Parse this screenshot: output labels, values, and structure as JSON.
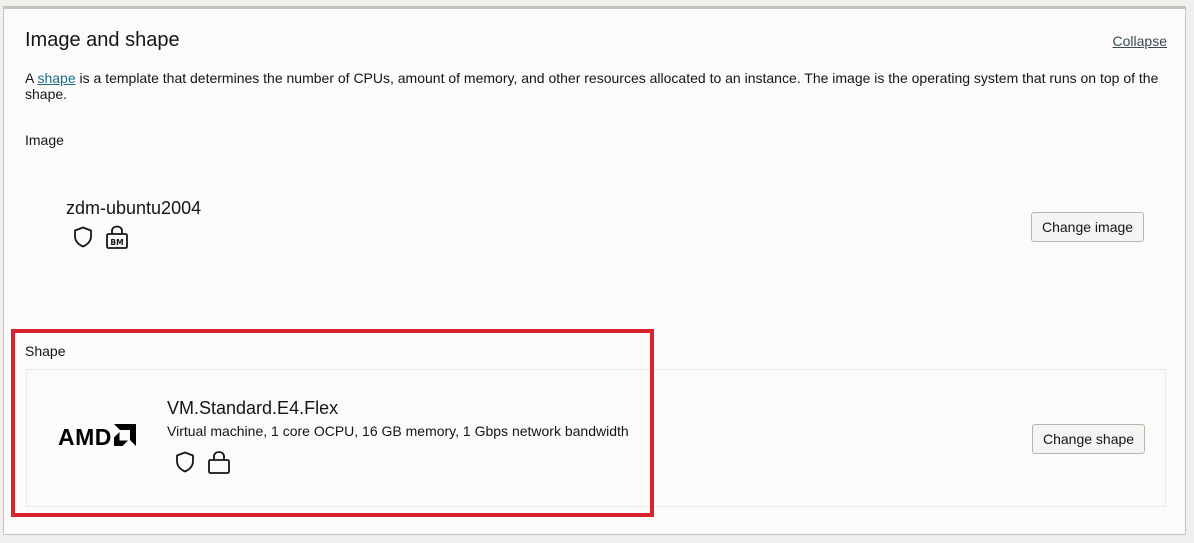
{
  "header": {
    "title": "Image and shape",
    "collapse_label": "Collapse"
  },
  "description": {
    "prefix": "A ",
    "link_text": "shape",
    "suffix": " is a template that determines the number of CPUs, amount of memory, and other resources allocated to an instance. The image is the operating system that runs on top of the shape."
  },
  "image_section": {
    "label": "Image",
    "name": "zdm-ubuntu2004",
    "icons": [
      "shield-icon",
      "bare-metal-lock-icon"
    ],
    "change_button": "Change image"
  },
  "shape_section": {
    "label": "Shape",
    "vendor_logo": "AMD",
    "name": "VM.Standard.E4.Flex",
    "details": "Virtual machine, 1 core OCPU, 16 GB memory, 1 Gbps network bandwidth",
    "icons": [
      "shield-icon",
      "lock-icon"
    ],
    "change_button": "Change shape"
  },
  "colors": {
    "highlight": "#d9232e",
    "link": "#1b6d86"
  }
}
